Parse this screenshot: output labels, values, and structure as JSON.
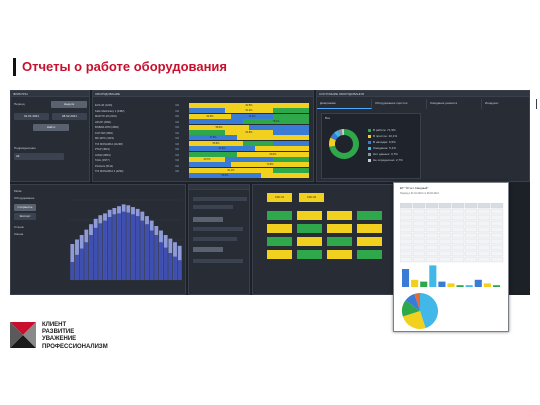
{
  "slide": {
    "title": "Отчеты о работе оборудования",
    "motto": [
      "КЛИЕНТ",
      "РАЗВИТИЕ",
      "УВАЖЕНИЕ",
      "ПРОФЕССИОНАЛИЗМ"
    ]
  },
  "colors": {
    "accent_red": "#c8102e",
    "dashboard_bg": "#1c2027",
    "panel_bg": "#272c35",
    "green": "#2ea84b",
    "yellow": "#f2d01e",
    "blue": "#3a7bd5",
    "light_blue": "#41b8e8"
  },
  "filters": {
    "title": "ФИЛЬТРЫ",
    "period_label": "Период",
    "mode_button": "Неделя",
    "date_from": "01.01.2021",
    "date_to": "28.02.2021",
    "apply_button": "Найти",
    "group_label": "Подразделение",
    "group_value": "All"
  },
  "equipment": {
    "title": "ОБОРУДОВАНИЕ",
    "items": [
      {
        "name": "ECS-36 (1234)",
        "count": "6/2"
      },
      {
        "name": "Kalin Mashinlary 1 (4482)",
        "count": "6/2"
      },
      {
        "name": "MAKITO-18 (2291)",
        "count": "6/2"
      },
      {
        "name": "HR-KP (2991)",
        "count": "6/2"
      },
      {
        "name": "BOBAR-KPM (4890)",
        "count": "6/2"
      },
      {
        "name": "KCP-5M (3981)",
        "count": "6/2"
      },
      {
        "name": "MK-WPC (4021)",
        "count": "6/2"
      },
      {
        "name": "TOI MONARKA (41298)",
        "count": "6/2"
      },
      {
        "name": "PTAP (4819)",
        "count": "6/2"
      },
      {
        "name": "LMGR (9819)",
        "count": "6/2"
      },
      {
        "name": "TAHL (3977)",
        "count": "6/2"
      },
      {
        "name": "Poinkers (5112)",
        "count": "6/2"
      },
      {
        "name": "TOI MONARKA 2 (4290)",
        "count": "6/2"
      }
    ]
  },
  "timeline": {
    "rows": [
      [
        [
          "yellow",
          100,
          "82.5%"
        ]
      ],
      [
        [
          "blue",
          30,
          ""
        ],
        [
          "yellow",
          40,
          "51.2%"
        ],
        [
          "green",
          30,
          ""
        ]
      ],
      [
        [
          "yellow",
          35,
          "62.0%"
        ],
        [
          "blue",
          35,
          "71.4%"
        ],
        [
          "green",
          30,
          ""
        ]
      ],
      [
        [
          "blue",
          45,
          ""
        ],
        [
          "green",
          55,
          "78.1%"
        ]
      ],
      [
        [
          "yellow",
          50,
          "58.3%"
        ],
        [
          "blue",
          50,
          ""
        ]
      ],
      [
        [
          "green",
          30,
          ""
        ],
        [
          "yellow",
          40,
          "64.8%"
        ],
        [
          "blue",
          30,
          ""
        ]
      ],
      [
        [
          "blue",
          40,
          "47.9%"
        ],
        [
          "yellow",
          60,
          ""
        ]
      ],
      [
        [
          "yellow",
          45,
          "55.6%"
        ],
        [
          "green",
          25,
          ""
        ],
        [
          "blue",
          30,
          ""
        ]
      ],
      [
        [
          "blue",
          55,
          "61.0%"
        ],
        [
          "yellow",
          45,
          ""
        ]
      ],
      [
        [
          "green",
          40,
          ""
        ],
        [
          "yellow",
          60,
          "69.2%"
        ]
      ],
      [
        [
          "yellow",
          30,
          "40.7%"
        ],
        [
          "blue",
          40,
          ""
        ],
        [
          "green",
          30,
          ""
        ]
      ],
      [
        [
          "blue",
          35,
          ""
        ],
        [
          "yellow",
          65,
          "73.5%"
        ]
      ],
      [
        [
          "yellow",
          70,
          "81.1%"
        ],
        [
          "green",
          30,
          ""
        ]
      ],
      [
        [
          "blue",
          60,
          "66.3%"
        ],
        [
          "yellow",
          40,
          ""
        ]
      ]
    ]
  },
  "status_panel": {
    "title": "СОСТОЯНИЕ ОБОРУДОВАНИЯ",
    "tabs": [
      "Диаграмма",
      "Оборудование простоя",
      "Ожидание ремонта",
      "Инцидент"
    ],
    "header": "Все",
    "legend": [
      {
        "label": "В работе: 71,9%",
        "color": "#2ea84b"
      },
      {
        "label": "В простое: 10,1%",
        "color": "#f2d01e"
      },
      {
        "label": "В наладке: 6,5%",
        "color": "#3a7bd5"
      },
      {
        "label": "Ожидание: 5,1%",
        "color": "#41b8e8"
      },
      {
        "label": "Нет данных: 3,7%",
        "color": "#8892a0"
      },
      {
        "label": "Не определено: 2,7%",
        "color": "#c9ccd1"
      }
    ],
    "pie": [
      71.9,
      10.1,
      6.5,
      5.1,
      3.7,
      2.7
    ]
  },
  "bar_chart": {
    "left_labels": [
      "Mode",
      "Оборудование",
      "Станок",
      "Смена"
    ],
    "buttons": [
      "Сохранить",
      "Экспорт"
    ],
    "series": [
      [
        20,
        28,
        35,
        42,
        50,
        58,
        63,
        66,
        70,
        73,
        74,
        76,
        75,
        73,
        71,
        66,
        62,
        55,
        50,
        42,
        36,
        30,
        26,
        22
      ],
      [
        40,
        45,
        50,
        56,
        62,
        68,
        72,
        74,
        78,
        80,
        82,
        84,
        83,
        81,
        79,
        76,
        71,
        66,
        60,
        55,
        50,
        46,
        42,
        38
      ]
    ]
  },
  "tile_panel": {
    "top": [
      {
        "label": "CNC 01",
        "color": "yellow"
      },
      {
        "label": "CNC 02",
        "color": "yellow"
      }
    ],
    "grid": [
      [
        "green",
        "yellow",
        "yellow",
        "green"
      ],
      [
        "yellow",
        "green",
        "yellow",
        "yellow"
      ],
      [
        "green",
        "yellow",
        "green",
        "yellow"
      ],
      [
        "yellow",
        "green",
        "yellow",
        "green"
      ]
    ]
  },
  "report": {
    "title": "ЕТ \"Отчет Сводный\"",
    "subtitle": "Период с 01.01.2021 по 28.02.2021",
    "bars": [
      10,
      4,
      3,
      12,
      3,
      2,
      1,
      1,
      4,
      2,
      1
    ],
    "pie": [
      45,
      25,
      15,
      10,
      5
    ]
  }
}
